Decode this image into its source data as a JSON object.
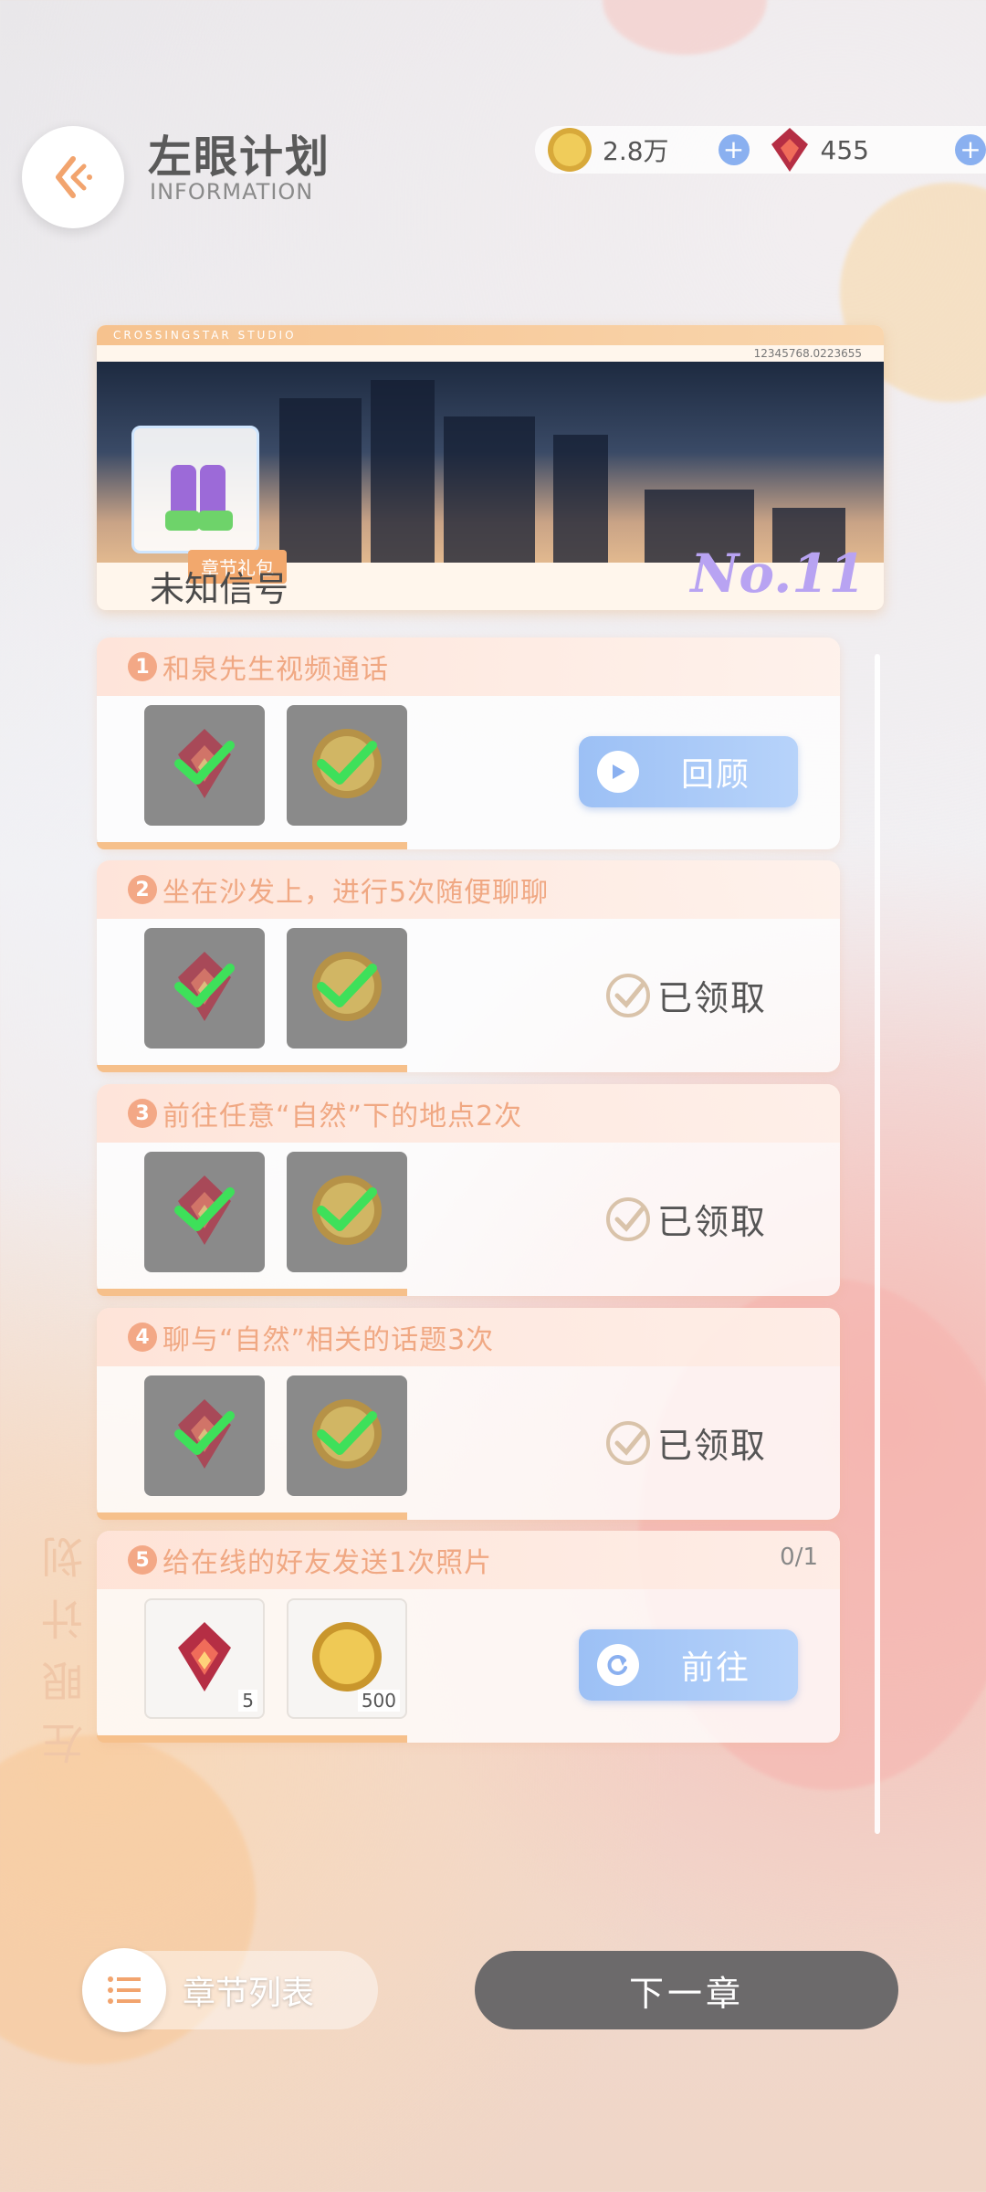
{
  "header": {
    "title": "左眼计划",
    "subtitle": "INFORMATION"
  },
  "currency": {
    "coins": "2.8万",
    "gems": "455"
  },
  "banner": {
    "studio": "CROSSINGSTAR STUDIO",
    "code": "12345768.0223655",
    "gift_label": "章节礼包",
    "name": "未知信号",
    "number": "No.11"
  },
  "tasks": [
    {
      "num": "1",
      "title": "和泉先生视频通话",
      "status": "button",
      "button": "回顾",
      "rewards": [
        "gem-icon",
        "coin-icon"
      ],
      "claimed": true
    },
    {
      "num": "2",
      "title": "坐在沙发上，进行5次随便聊聊",
      "status": "claimed",
      "label": "已领取",
      "rewards": [
        "gem-icon",
        "coin-icon"
      ],
      "claimed": true
    },
    {
      "num": "3",
      "title": "前往任意“自然”下的地点2次",
      "status": "claimed",
      "label": "已领取",
      "rewards": [
        "gem-icon",
        "coin-icon"
      ],
      "claimed": true
    },
    {
      "num": "4",
      "title": "聊与“自然”相关的话题3次",
      "status": "claimed",
      "label": "已领取",
      "rewards": [
        "gem-icon",
        "coin-icon"
      ],
      "claimed": true
    },
    {
      "num": "5",
      "title": "给在线的好友发送1次照片",
      "status": "button",
      "button": "前往",
      "progress": "0/1",
      "rewards": [
        "gem-icon",
        "coin-icon"
      ],
      "reward_counts": [
        "5",
        "500"
      ],
      "claimed": false
    }
  ],
  "side_text": "左眼计划",
  "bottom": {
    "chapter_list": "章节列表",
    "next": "下一章"
  },
  "colors": {
    "accent_orange": "#f3a886",
    "button_blue": "#9cc0f5",
    "next_button": "#6c6a6b"
  }
}
